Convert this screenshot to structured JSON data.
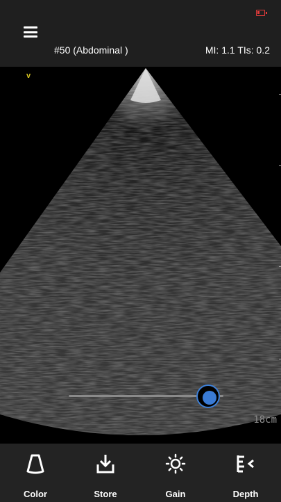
{
  "header": {
    "preset": "#50 (Abdominal )",
    "indices": "MI: 1.1  TIs: 0.2",
    "battery_color": "#e23b3b"
  },
  "image": {
    "orientation_mark": "v",
    "depth": "18cm",
    "gain_slider_level": 0.9
  },
  "toolbar": {
    "items": [
      {
        "label": "Color",
        "icon": "color-icon"
      },
      {
        "label": "Store",
        "icon": "store-icon"
      },
      {
        "label": "Gain",
        "icon": "gain-icon"
      },
      {
        "label": "Depth",
        "icon": "depth-icon"
      }
    ]
  },
  "colors": {
    "accent": "#3a7bd5",
    "marker": "#d4c220"
  }
}
